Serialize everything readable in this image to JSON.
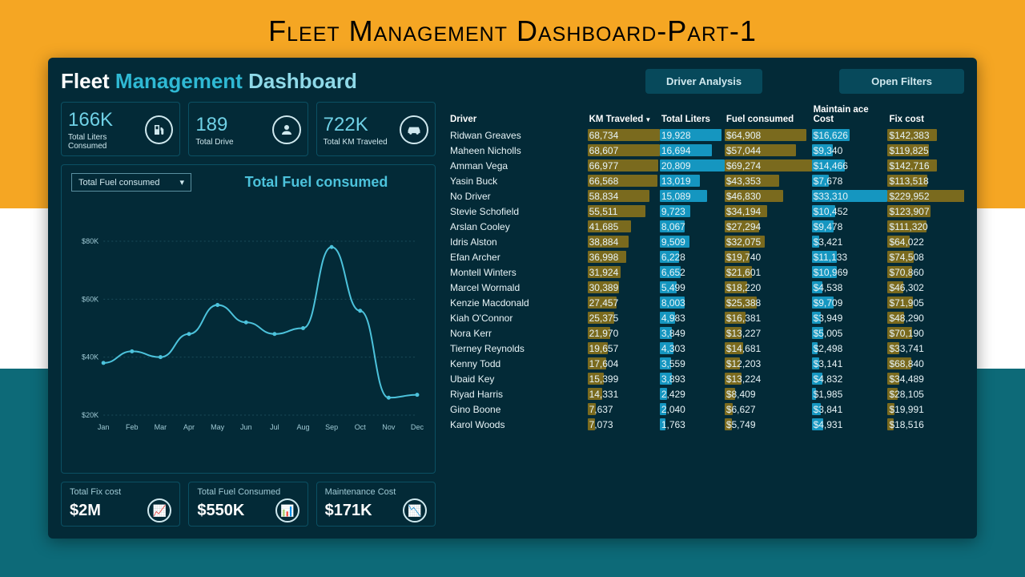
{
  "page": {
    "title": "Fleet Management Dashboard-Part-1"
  },
  "header": {
    "title_w1": "Fleet ",
    "title_w2": "Management ",
    "title_w3": "Dashboard",
    "btn_driver": "Driver Analysis",
    "btn_filters": "Open Filters"
  },
  "kpis": {
    "liters": {
      "value": "166K",
      "label": "Total Liters Consumed"
    },
    "drive": {
      "value": "189",
      "label": "Total Drive"
    },
    "km": {
      "value": "722K",
      "label": "Total KM Traveled"
    }
  },
  "chart": {
    "selector": "Total Fuel consumed",
    "title": "Total Fuel consumed"
  },
  "chart_data": {
    "type": "line",
    "categories": [
      "Jan",
      "Feb",
      "Mar",
      "Apr",
      "May",
      "Jun",
      "Jul",
      "Aug",
      "Sep",
      "Oct",
      "Nov",
      "Dec"
    ],
    "values": [
      38000,
      42000,
      40000,
      48000,
      58000,
      52000,
      48000,
      50000,
      78000,
      56000,
      26000,
      27000
    ],
    "ylim": [
      20000,
      80000
    ],
    "yticks": [
      "$20K",
      "$40K",
      "$60K",
      "$80K"
    ],
    "ylabel": "",
    "xlabel": "",
    "title": "Total Fuel consumed"
  },
  "bottom": {
    "fix": {
      "label": "Total Fix cost",
      "value": "$2M"
    },
    "fuel": {
      "label": "Total Fuel Consumed",
      "value": "$550K"
    },
    "maint": {
      "label": "Maintenance Cost",
      "value": "$171K"
    }
  },
  "table": {
    "columns": [
      "Driver",
      "KM Traveled",
      "Total Liters",
      "Fuel consumed",
      "Maintain ace Cost",
      "Fix cost"
    ],
    "sort_col": 1,
    "rows": [
      {
        "driver": "Ridwan Greaves",
        "km": "68,734",
        "liters": "19,928",
        "fuel": "$64,908",
        "maint": "$16,626",
        "fix": "$142,383"
      },
      {
        "driver": "Maheen Nicholls",
        "km": "68,607",
        "liters": "16,694",
        "fuel": "$57,044",
        "maint": "$9,340",
        "fix": "$119,825"
      },
      {
        "driver": "Amman Vega",
        "km": "66,977",
        "liters": "20,809",
        "fuel": "$69,274",
        "maint": "$14,466",
        "fix": "$142,716"
      },
      {
        "driver": "Yasin Buck",
        "km": "66,568",
        "liters": "13,019",
        "fuel": "$43,353",
        "maint": "$7,678",
        "fix": "$113,518"
      },
      {
        "driver": "No Driver",
        "km": "58,834",
        "liters": "15,089",
        "fuel": "$46,830",
        "maint": "$33,310",
        "fix": "$229,952"
      },
      {
        "driver": "Stevie Schofield",
        "km": "55,511",
        "liters": "9,723",
        "fuel": "$34,194",
        "maint": "$10,452",
        "fix": "$123,907"
      },
      {
        "driver": "Arslan Cooley",
        "km": "41,685",
        "liters": "8,067",
        "fuel": "$27,294",
        "maint": "$9,478",
        "fix": "$111,320"
      },
      {
        "driver": "Idris Alston",
        "km": "38,884",
        "liters": "9,509",
        "fuel": "$32,075",
        "maint": "$3,421",
        "fix": "$64,022"
      },
      {
        "driver": "Efan Archer",
        "km": "36,998",
        "liters": "6,228",
        "fuel": "$19,740",
        "maint": "$11,133",
        "fix": "$74,508"
      },
      {
        "driver": "Montell Winters",
        "km": "31,924",
        "liters": "6,652",
        "fuel": "$21,601",
        "maint": "$10,969",
        "fix": "$70,860"
      },
      {
        "driver": "Marcel Wormald",
        "km": "30,389",
        "liters": "5,499",
        "fuel": "$18,220",
        "maint": "$4,538",
        "fix": "$46,302"
      },
      {
        "driver": "Kenzie Macdonald",
        "km": "27,457",
        "liters": "8,003",
        "fuel": "$25,388",
        "maint": "$9,709",
        "fix": "$71,905"
      },
      {
        "driver": "Kiah O'Connor",
        "km": "25,375",
        "liters": "4,983",
        "fuel": "$16,381",
        "maint": "$3,949",
        "fix": "$48,290"
      },
      {
        "driver": "Nora Kerr",
        "km": "21,970",
        "liters": "3,849",
        "fuel": "$13,227",
        "maint": "$5,005",
        "fix": "$70,190"
      },
      {
        "driver": "Tierney Reynolds",
        "km": "19,657",
        "liters": "4,303",
        "fuel": "$14,681",
        "maint": "$2,498",
        "fix": "$33,741"
      },
      {
        "driver": "Kenny Todd",
        "km": "17,604",
        "liters": "3,559",
        "fuel": "$12,203",
        "maint": "$3,141",
        "fix": "$68,840"
      },
      {
        "driver": "Ubaid Key",
        "km": "15,399",
        "liters": "3,893",
        "fuel": "$13,224",
        "maint": "$4,832",
        "fix": "$34,489"
      },
      {
        "driver": "Riyad Harris",
        "km": "14,331",
        "liters": "2,429",
        "fuel": "$8,409",
        "maint": "$1,985",
        "fix": "$28,105"
      },
      {
        "driver": "Gino Boone",
        "km": "7,637",
        "liters": "2,040",
        "fuel": "$6,627",
        "maint": "$3,841",
        "fix": "$19,991"
      },
      {
        "driver": "Karol Woods",
        "km": "7,073",
        "liters": "1,763",
        "fuel": "$5,749",
        "maint": "$4,931",
        "fix": "$18,516"
      }
    ],
    "max": {
      "km": 68734,
      "liters": 20809,
      "fuel": 69274,
      "maint": 33310,
      "fix": 229952
    }
  },
  "colors": {
    "barYellow": "#7a6a1e",
    "barBlue": "#1596c0"
  }
}
